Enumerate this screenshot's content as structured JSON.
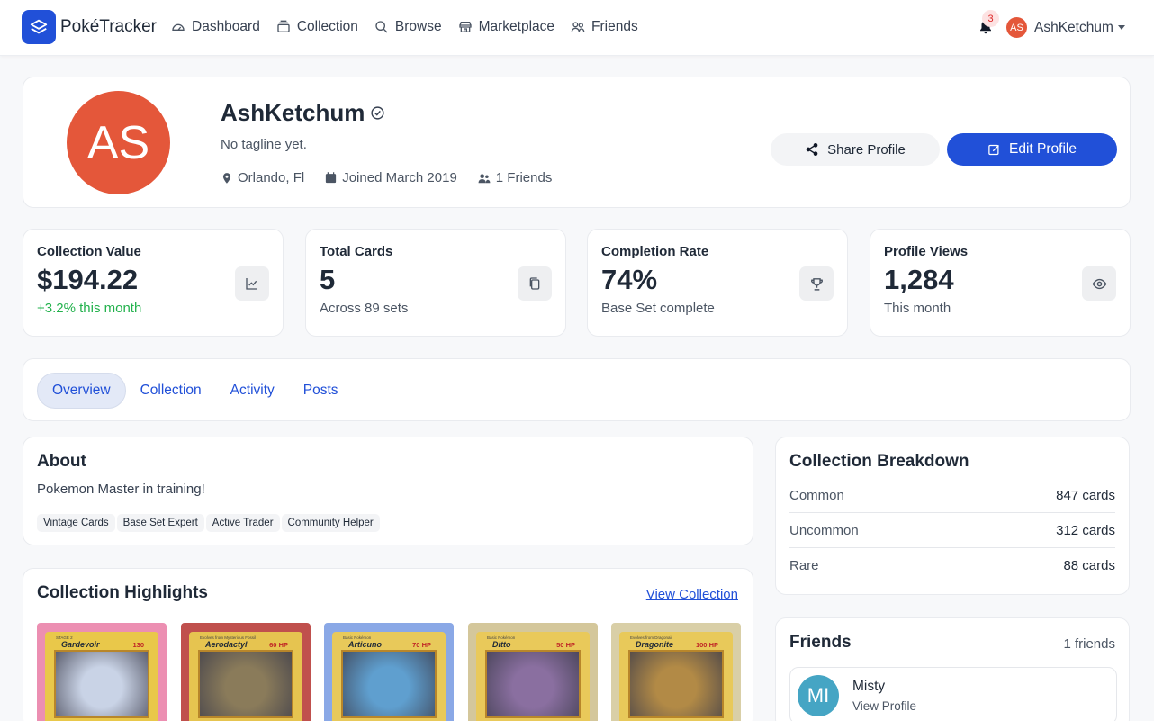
{
  "nav": {
    "brand": "PokéTracker",
    "links": [
      {
        "label": "Dashboard",
        "icon": "dashboard-gauge-icon"
      },
      {
        "label": "Collection",
        "icon": "collection-stack-icon"
      },
      {
        "label": "Browse",
        "icon": "search-icon"
      },
      {
        "label": "Marketplace",
        "icon": "store-icon"
      },
      {
        "label": "Friends",
        "icon": "users-icon"
      }
    ],
    "notification_count": "3",
    "user_initials": "AS",
    "user_name": "AshKetchum"
  },
  "profile": {
    "initials": "AS",
    "name": "AshKetchum",
    "tagline": "No tagline yet.",
    "location": "Orlando, Fl",
    "joined": "Joined March 2019",
    "friends": "1 Friends",
    "share_label": "Share Profile",
    "edit_label": "Edit Profile",
    "avatar_color": "#e4573a"
  },
  "stats": [
    {
      "label": "Collection Value",
      "value": "$194.22",
      "sub": "+3.2% this month",
      "icon": "chart-line-icon"
    },
    {
      "label": "Total Cards",
      "value": "5",
      "sub": "Across 89 sets",
      "icon": "copy-cards-icon"
    },
    {
      "label": "Completion Rate",
      "value": "74%",
      "sub": "Base Set complete",
      "icon": "trophy-icon"
    },
    {
      "label": "Profile Views",
      "value": "1,284",
      "sub": "This month",
      "icon": "eye-icon"
    }
  ],
  "tabs": [
    "Overview",
    "Collection",
    "Activity",
    "Posts"
  ],
  "active_tab": "Overview",
  "about": {
    "title": "About",
    "text": "Pokemon Master in training!",
    "tags": [
      "Vintage Cards",
      "Base Set Expert",
      "Active Trader",
      "Community Helper"
    ]
  },
  "highlights": {
    "title": "Collection Highlights",
    "view_link": "View Collection",
    "cards": [
      {
        "name": "Gardevoir",
        "hp": "130",
        "stage": "STAGE 2",
        "border": "#ec8fb2",
        "frame": "#e9c84a",
        "art": "#c9d3e6"
      },
      {
        "name": "Aerodactyl",
        "hp": "60 HP",
        "stage": "Evolves from Mysterious Fossil",
        "border": "#c0504d",
        "frame": "#e6c450",
        "art": "#8a7b5a"
      },
      {
        "name": "Articuno",
        "hp": "70 HP",
        "stage": "Basic Pokémon",
        "border": "#8aa8e6",
        "frame": "#e8c95a",
        "art": "#5f9fcf"
      },
      {
        "name": "Ditto",
        "hp": "50 HP",
        "stage": "Basic Pokémon",
        "border": "#d4c79b",
        "frame": "#e9c95a",
        "art": "#8a6fa0"
      },
      {
        "name": "Dragonite",
        "hp": "100 HP",
        "stage": "Evolves from Dragonair",
        "border": "#d9cfa7",
        "frame": "#e8c95a",
        "art": "#b28a46"
      }
    ]
  },
  "breakdown": {
    "title": "Collection Breakdown",
    "rows": [
      {
        "label": "Common",
        "value": "847 cards"
      },
      {
        "label": "Uncommon",
        "value": "312 cards"
      },
      {
        "label": "Rare",
        "value": "88 cards"
      }
    ]
  },
  "friends": {
    "title": "Friends",
    "count": "1 friends",
    "items": [
      {
        "initials": "MI",
        "name": "Misty",
        "action": "View Profile"
      }
    ]
  },
  "colors": {
    "primary": "#2150d8",
    "success": "#22b14c",
    "avatar": "#e4573a",
    "friend_avatar": "#45a5c4"
  }
}
